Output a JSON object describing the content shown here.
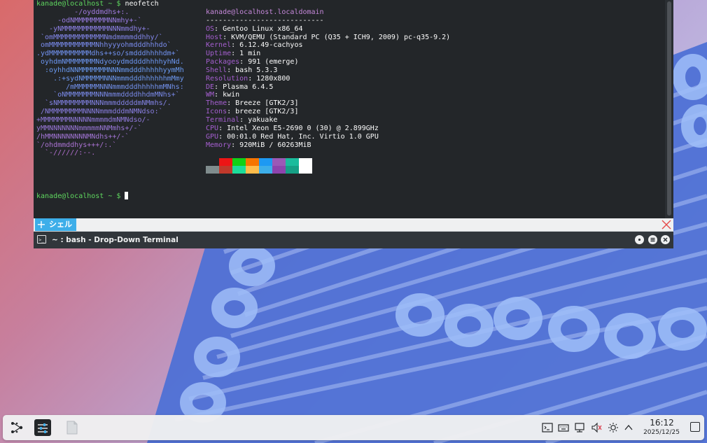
{
  "terminal": {
    "command_prompt": "kanade@localhost ~ $",
    "command": "neofetch",
    "idle_prompt": "kanade@localhost ~ $",
    "ascii_logo": [
      "         -/oyddmdhs+:.",
      "     -odNMMMMMMMMNNmhy+-`",
      "   -yNMMMMMMMMMMMNNNmmdhy+-",
      " `omMMMMMMMMMMMMNmdmmmmddhhy/`",
      " omMMMMMMMMMMMNhhyyyohmdddhhhdo`",
      ".ydMMMMMMMMMMdhs++so/smdddhhhhdm+`",
      " oyhdmNMMMMMMMNdyooydmddddhhhhyhNd.",
      "  :oyhhdNNMMMMMMMNNNmmdddhhhhhyymMh",
      "    .:+sydNMMMMMNNNmmmdddhhhhhhmMmy",
      "       /mMMMMMMNNNmmmdddhhhhhmMNhs:",
      "    `oNMMMMMMMNNNmmmddddhhdmMNhs+`",
      "  `sNMMMMMMMMNNNmmmdddddmNMmhs/.",
      " /NMMMMMMMMNNNNmmmdddmNMNdso:`",
      "+MMMMMMMNNNNNmmmmdmNMNdso/-",
      "yMMNNNNNNNmmmmmNNMmhs+/-`",
      "/hMMNNNNNNNNMNdhs++/-`",
      "`/ohdmmddhys+++/:.`",
      "  `-//////:--."
    ],
    "user_host": "kanade@localhost.localdomain",
    "separator": "----------------------------",
    "info": [
      {
        "key": "OS",
        "value": "Gentoo Linux x86_64"
      },
      {
        "key": "Host",
        "value": "KVM/QEMU (Standard PC (Q35 + ICH9, 2009) pc-q35-9.2)"
      },
      {
        "key": "Kernel",
        "value": "6.12.49-cachyos"
      },
      {
        "key": "Uptime",
        "value": "1 min"
      },
      {
        "key": "Packages",
        "value": "991 (emerge)"
      },
      {
        "key": "Shell",
        "value": "bash 5.3.3"
      },
      {
        "key": "Resolution",
        "value": "1280x800"
      },
      {
        "key": "DE",
        "value": "Plasma 6.4.5"
      },
      {
        "key": "WM",
        "value": "kwin"
      },
      {
        "key": "Theme",
        "value": "Breeze [GTK2/3]"
      },
      {
        "key": "Icons",
        "value": "breeze [GTK2/3]"
      },
      {
        "key": "Terminal",
        "value": "yakuake"
      },
      {
        "key": "CPU",
        "value": "Intel Xeon E5-2690 0 (30) @ 2.899GHz"
      },
      {
        "key": "GPU",
        "value": "00:01.0 Red Hat, Inc. Virtio 1.0 GPU"
      },
      {
        "key": "Memory",
        "value": "920MiB / 60263MiB"
      }
    ],
    "palette_top": [
      "#232629",
      "#ed1515",
      "#11d116",
      "#f67400",
      "#1d99f3",
      "#9b59b6",
      "#1abc9c"
    ],
    "palette_bottom": [
      "#7f8c8d",
      "#c0392b",
      "#1cdc9a",
      "#fdbc4b",
      "#3daee9",
      "#8e44ad",
      "#16a085"
    ],
    "palette_white": "#ffffff"
  },
  "tabbar": {
    "tab_label": "シェル"
  },
  "titlebar": {
    "title": "~ : bash - Drop-Down Terminal"
  },
  "taskbar": {
    "clock_time": "16:12",
    "clock_date": "2025/12/25"
  },
  "colors": {
    "accent": "#3daee9",
    "terminal_bg": "#232629"
  }
}
